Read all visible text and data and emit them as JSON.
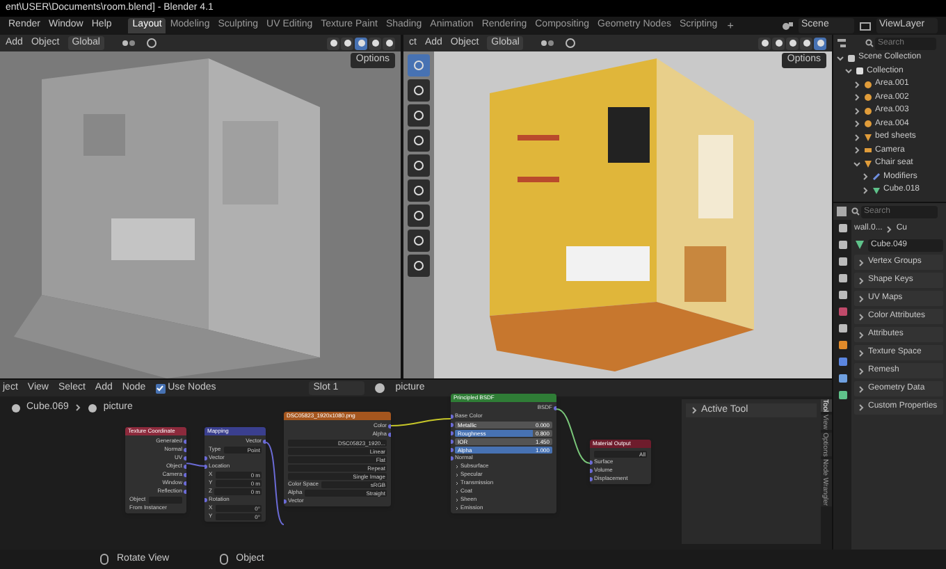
{
  "title_bar": {
    "title": "ent\\USER\\Documents\\room.blend] - Blender 4.1"
  },
  "menu": [
    "Render",
    "Window",
    "Help"
  ],
  "workspace_tabs": [
    {
      "label": "Layout",
      "selected": true
    },
    {
      "label": "Modeling",
      "selected": false
    },
    {
      "label": "Sculpting",
      "selected": false
    },
    {
      "label": "UV Editing",
      "selected": false
    },
    {
      "label": "Texture Paint",
      "selected": false
    },
    {
      "label": "Shading",
      "selected": false
    },
    {
      "label": "Animation",
      "selected": false
    },
    {
      "label": "Rendering",
      "selected": false
    },
    {
      "label": "Compositing",
      "selected": false
    },
    {
      "label": "Geometry Nodes",
      "selected": false
    },
    {
      "label": "Scripting",
      "selected": false
    }
  ],
  "add_workspace": "+",
  "scene": "Scene",
  "view_layer": "ViewLayer",
  "viewports": [
    {
      "kind": "solid",
      "menus": [
        "Add",
        "Object"
      ],
      "orientation": "Global",
      "options": "Options",
      "shading_modes": [
        {
          "selected": false
        },
        {
          "selected": false
        },
        {
          "selected": true
        },
        {
          "selected": false
        },
        {
          "selected": false
        }
      ]
    },
    {
      "kind": "rendered",
      "mode": "ct",
      "menus": [
        "Add",
        "Object"
      ],
      "orientation": "Global",
      "options": "Options",
      "shading_modes": [
        {
          "selected": false
        },
        {
          "selected": false
        },
        {
          "selected": false
        },
        {
          "selected": false
        },
        {
          "selected": true
        }
      ]
    }
  ],
  "outliner": {
    "search_placeholder": "Search",
    "tree": [
      {
        "label": "Scene Collection",
        "kind": "scene",
        "expanded": true,
        "children": [
          {
            "label": "Collection",
            "kind": "collection",
            "expanded": true,
            "children": [
              {
                "label": "Area.001",
                "kind": "light",
                "expanded": false
              },
              {
                "label": "Area.002",
                "kind": "light",
                "expanded": false
              },
              {
                "label": "Area.003",
                "kind": "light",
                "expanded": false
              },
              {
                "label": "Area.004",
                "kind": "light",
                "expanded": false
              },
              {
                "label": "bed sheets",
                "kind": "object",
                "expanded": false
              },
              {
                "label": "Camera",
                "kind": "camera",
                "expanded": false
              },
              {
                "label": "Chair seat",
                "kind": "object",
                "expanded": true,
                "children": [
                  {
                    "label": "Modifiers",
                    "kind": "modifier",
                    "expanded": false
                  },
                  {
                    "label": "Cube.018",
                    "kind": "mesh",
                    "expanded": false
                  }
                ]
              }
            ]
          }
        ]
      }
    ]
  },
  "properties": {
    "search_placeholder": "Search",
    "breadcrumb": [
      "wall.0...",
      "Cu"
    ],
    "datablock": "Cube.049",
    "panels": [
      "Vertex Groups",
      "Shape Keys",
      "UV Maps",
      "Color Attributes",
      "Attributes",
      "Texture Space",
      "Remesh",
      "Geometry Data",
      "Custom Properties"
    ]
  },
  "node_editor": {
    "menus": [
      "ject",
      "View",
      "Select",
      "Add",
      "Node"
    ],
    "use_nodes": {
      "label": "Use Nodes",
      "checked": true
    },
    "slot": "Slot 1",
    "material": "picture",
    "breadcrumb": [
      "Cube.069",
      "picture"
    ],
    "nodes": [
      {
        "title": "Texture Coordinate",
        "color": "#8c2a3c",
        "rows": [
          {
            "kind": "out",
            "label": "Generated"
          },
          {
            "kind": "out",
            "label": "Normal"
          },
          {
            "kind": "out",
            "label": "UV"
          },
          {
            "kind": "out",
            "label": "Object"
          },
          {
            "kind": "out",
            "label": "Camera"
          },
          {
            "kind": "out",
            "label": "Window"
          },
          {
            "kind": "out",
            "label": "Reflection"
          },
          {
            "kind": "field",
            "label": "Object",
            "value": ""
          },
          {
            "kind": "check",
            "label": "From Instancer"
          }
        ]
      },
      {
        "title": "Mapping",
        "color": "#3a3f8f",
        "rows": [
          {
            "kind": "out",
            "label": "Vector"
          },
          {
            "kind": "dropdown",
            "label": "Type",
            "value": "Point"
          },
          {
            "kind": "in",
            "label": "Vector"
          },
          {
            "kind": "in",
            "label": "Location"
          },
          {
            "kind": "field",
            "label": "X",
            "value": "0 m"
          },
          {
            "kind": "field",
            "label": "Y",
            "value": "0 m"
          },
          {
            "kind": "field",
            "label": "Z",
            "value": "0 m"
          },
          {
            "kind": "in",
            "label": "Rotation"
          },
          {
            "kind": "field",
            "label": "X",
            "value": "0°"
          },
          {
            "kind": "field",
            "label": "Y",
            "value": "0°"
          }
        ]
      },
      {
        "title": "DSC05823_1920x1080.png",
        "color": "#a5561e",
        "rows": [
          {
            "kind": "out",
            "label": "Color"
          },
          {
            "kind": "out",
            "label": "Alpha"
          },
          {
            "kind": "image",
            "value": "DSC05823_1920..."
          },
          {
            "kind": "dropdown",
            "label": "",
            "value": "Linear"
          },
          {
            "kind": "dropdown",
            "label": "",
            "value": "Flat"
          },
          {
            "kind": "dropdown",
            "label": "",
            "value": "Repeat"
          },
          {
            "kind": "dropdown",
            "label": "",
            "value": "Single Image"
          },
          {
            "kind": "dropdown",
            "label": "Color Space",
            "value": "sRGB"
          },
          {
            "kind": "dropdown",
            "label": "Alpha",
            "value": "Straight"
          },
          {
            "kind": "in",
            "label": "Vector"
          }
        ]
      },
      {
        "title": "Principled BSDF",
        "color": "#2f7d36",
        "rows": [
          {
            "kind": "out",
            "label": "BSDF"
          },
          {
            "kind": "in",
            "label": "Base Color"
          },
          {
            "kind": "slider",
            "label": "Metallic",
            "value": "0.000",
            "level": 0
          },
          {
            "kind": "slider",
            "label": "Roughness",
            "value": "0.800",
            "level": 0.8
          },
          {
            "kind": "slider",
            "label": "IOR",
            "value": "1.450",
            "level": 0
          },
          {
            "kind": "slider",
            "label": "Alpha",
            "value": "1.000",
            "level": 1
          },
          {
            "kind": "in",
            "label": "Normal"
          },
          {
            "kind": "panel",
            "label": "Subsurface"
          },
          {
            "kind": "panel",
            "label": "Specular"
          },
          {
            "kind": "panel",
            "label": "Transmission"
          },
          {
            "kind": "panel",
            "label": "Coat"
          },
          {
            "kind": "panel",
            "label": "Sheen"
          },
          {
            "kind": "panel",
            "label": "Emission"
          }
        ]
      },
      {
        "title": "Material Output",
        "color": "#6e1c2c",
        "rows": [
          {
            "kind": "dropdown",
            "label": "",
            "value": "All"
          },
          {
            "kind": "in",
            "label": "Surface"
          },
          {
            "kind": "in",
            "label": "Volume"
          },
          {
            "kind": "in",
            "label": "Displacement"
          }
        ]
      }
    ],
    "sidebar": {
      "panel": "Active Tool",
      "tabs": [
        {
          "label": "Tool",
          "selected": true
        },
        {
          "label": "View",
          "selected": false
        },
        {
          "label": "Options",
          "selected": false
        },
        {
          "label": "Node Wrangler",
          "selected": false
        }
      ]
    }
  },
  "status_bar": [
    "Rotate View",
    "Object"
  ]
}
